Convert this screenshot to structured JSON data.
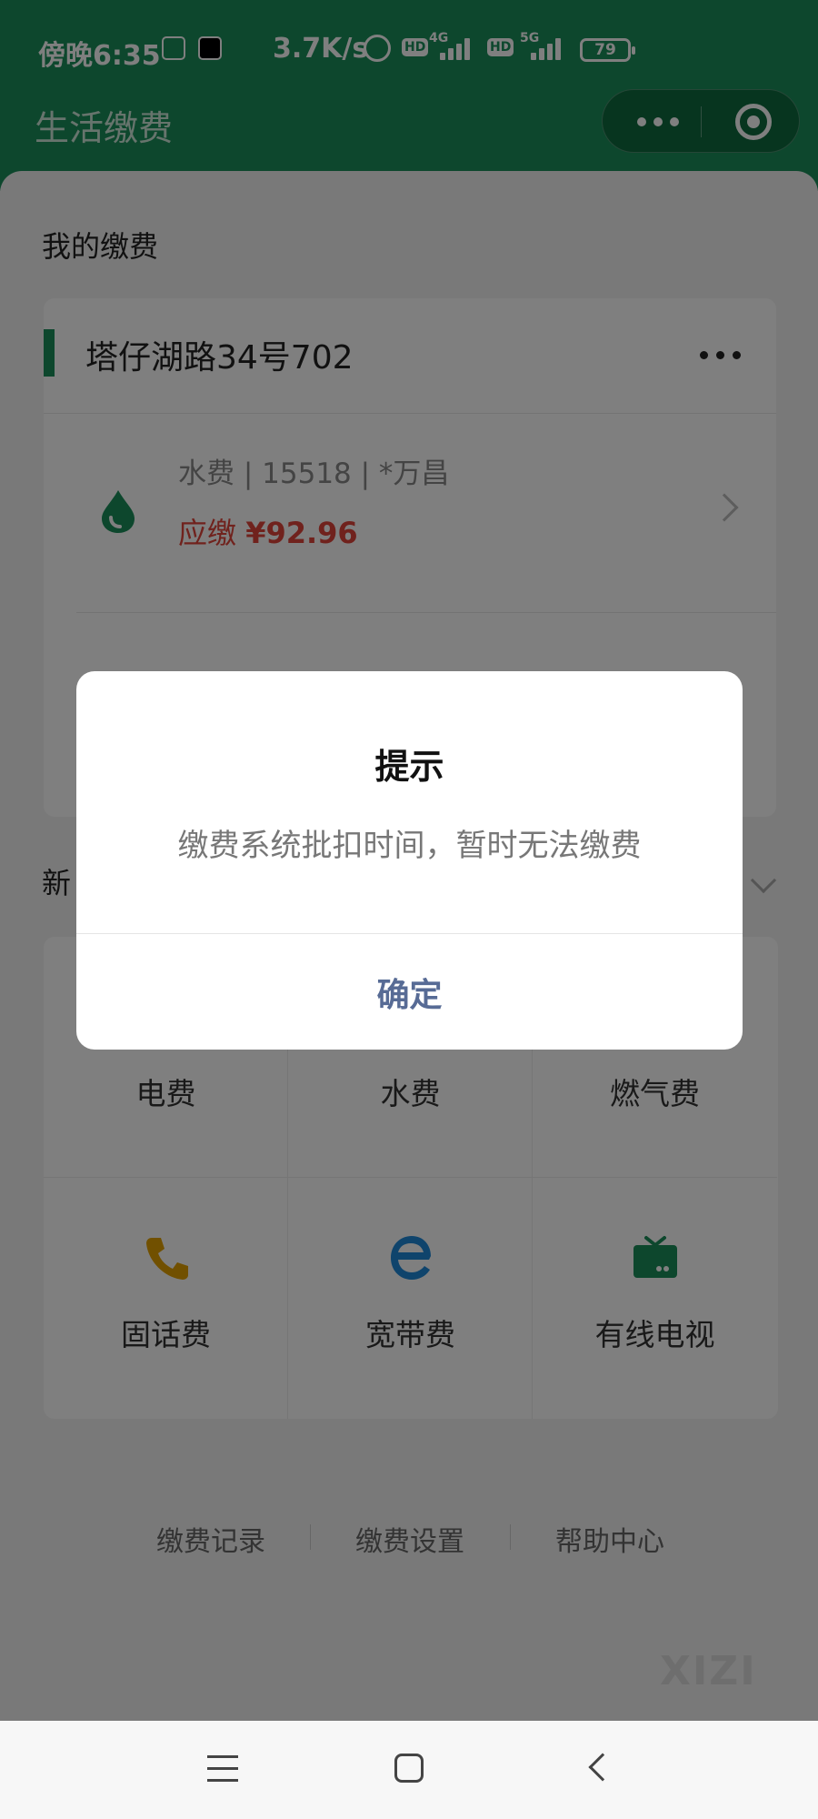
{
  "status_bar": {
    "time": "傍晚6:35",
    "speed": "3.7K/s",
    "net_4g": "4G",
    "net_5g": "5G",
    "hd": "HD",
    "battery": "79"
  },
  "nav": {
    "title": "生活缴费"
  },
  "my_bills": {
    "section_title": "我的缴费",
    "address": "塔仔湖路34号702",
    "item": {
      "meta": "水费 | 15518 | *万昌",
      "due_label": "应缴",
      "due_amount": "¥92.96"
    }
  },
  "new_section": {
    "title_partial": "新"
  },
  "categories": [
    {
      "label": "电费",
      "icon": "electricity-icon"
    },
    {
      "label": "水费",
      "icon": "water-icon"
    },
    {
      "label": "燃气费",
      "icon": "gas-icon"
    },
    {
      "label": "固话费",
      "icon": "phone-icon"
    },
    {
      "label": "宽带费",
      "icon": "broadband-icon"
    },
    {
      "label": "有线电视",
      "icon": "tv-icon"
    }
  ],
  "footer_links": [
    "缴费记录",
    "缴费设置",
    "帮助中心"
  ],
  "watermark": "XIZI",
  "dialog": {
    "title": "提示",
    "message": "缴费系统批扣时间，暂时无法缴费",
    "confirm": "确定"
  },
  "colors": {
    "brand": "#1a8f5a",
    "due": "#e0443a",
    "dialog_button": "#576b95"
  }
}
